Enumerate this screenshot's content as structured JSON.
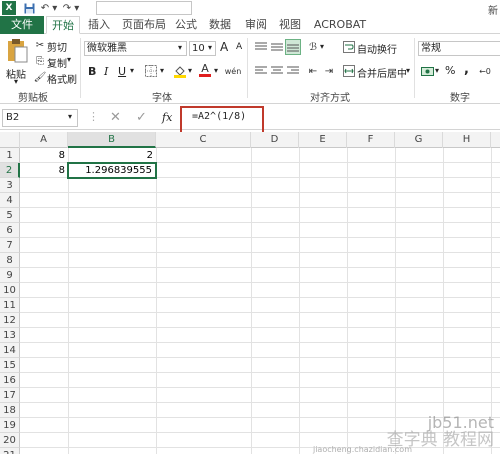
{
  "titlebar": {
    "app_icon": "X",
    "right_text": "新",
    "quick_access": [
      "save-icon",
      "undo-icon",
      "redo-icon"
    ]
  },
  "tabs": [
    "文件",
    "开始",
    "插入",
    "页面布局",
    "公式",
    "数据",
    "审阅",
    "视图",
    "ACROBAT"
  ],
  "clipboard": {
    "paste": "粘贴",
    "cut": "剪切",
    "copy": "复制",
    "format_painter": "格式刷",
    "label": "剪贴板"
  },
  "font": {
    "name": "微软雅黑",
    "size": "10",
    "grow": "A",
    "shrink": "A",
    "bold": "B",
    "italic": "I",
    "underline": "U",
    "color_letter": "A",
    "label": "字体"
  },
  "alignment": {
    "wrap": "自动换行",
    "merge": "合并后居中",
    "label": "对齐方式"
  },
  "number": {
    "format": "常规",
    "percent": "%",
    "comma": ",",
    "label": "数字"
  },
  "formula_bar": {
    "name_box": "B2",
    "fx": "fx",
    "formula": "=A2^(1/8)"
  },
  "grid": {
    "columns": [
      "A",
      "B",
      "C",
      "D",
      "E",
      "F",
      "G",
      "H"
    ],
    "rows": [
      "1",
      "2",
      "3",
      "4",
      "5",
      "6",
      "7",
      "8",
      "9",
      "10",
      "11",
      "12",
      "13",
      "14",
      "15",
      "16",
      "17",
      "18",
      "19",
      "20",
      "21"
    ],
    "cells": {
      "A1": "8",
      "B1": "2",
      "A2": "8",
      "B2": "1.296839555"
    },
    "selected": "B2"
  },
  "watermark": {
    "line1": "jb51.net",
    "line2": "查字典 教程网",
    "line3": "jiaocheng.chazidian.com"
  }
}
